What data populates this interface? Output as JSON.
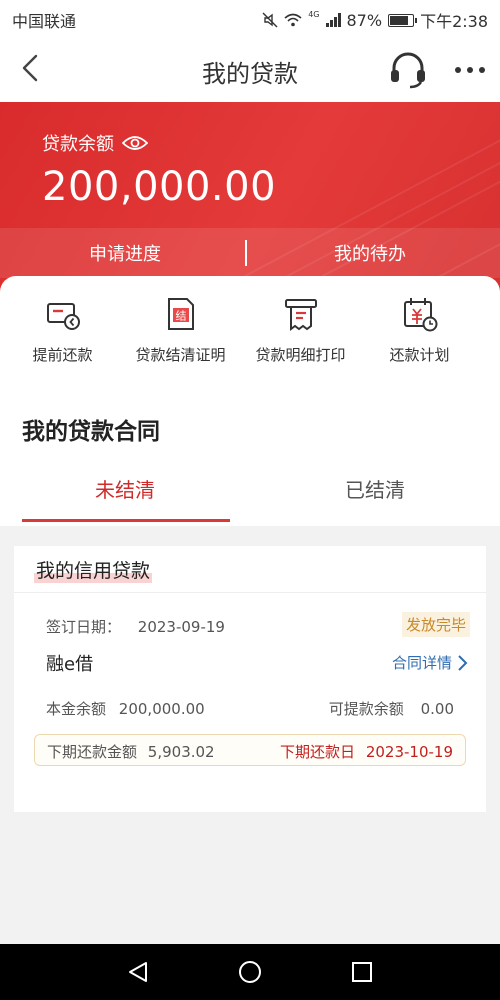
{
  "status_bar": {
    "carrier": "中国联通",
    "network": "4G",
    "battery": "87%",
    "battery_level": 0.87,
    "time": "下午2:38"
  },
  "nav": {
    "title": "我的贷款",
    "icons": [
      "back-arrow-icon",
      "headset-icon",
      "more-icon"
    ]
  },
  "balance": {
    "label": "贷款余额",
    "amount": "200,000.00"
  },
  "hero_tabs": [
    {
      "label": "申请进度"
    },
    {
      "label": "我的待办"
    }
  ],
  "quick_actions": [
    {
      "label": "提前还款",
      "icon": "early-repayment-icon"
    },
    {
      "label": "贷款结清证明",
      "icon": "settlement-certificate-icon",
      "icon_text": "结"
    },
    {
      "label": "贷款明细打印",
      "icon": "print-detail-icon"
    },
    {
      "label": "还款计划",
      "icon": "repayment-calendar-icon"
    }
  ],
  "section": {
    "title": "我的贷款合同",
    "tabs": [
      {
        "label": "未结清",
        "active": true
      },
      {
        "label": "已结清",
        "active": false
      }
    ]
  },
  "loan": {
    "title": "我的信用贷款",
    "sign_date_label": "签订日期：",
    "sign_date": "2023-09-19",
    "status": "发放完毕",
    "product": "融e借",
    "detail_link": "合同详情",
    "principal_label": "本金余额",
    "principal": "200,000.00",
    "withdrawable_label": "可提款余额",
    "withdrawable": "0.00",
    "next_amount_label": "下期还款金额",
    "next_amount": "5,903.02",
    "next_date_label": "下期还款日",
    "next_date": "2023-10-19"
  },
  "colors": {
    "brand_red": "#d92b2b",
    "link_blue": "#2f6db2",
    "badge_gold": "#c8892a"
  }
}
